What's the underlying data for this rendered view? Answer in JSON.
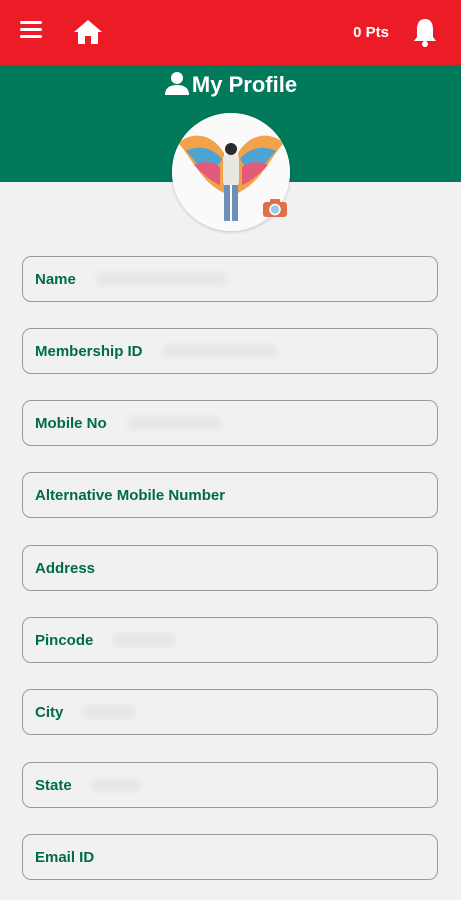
{
  "topbar": {
    "points_label": "0 Pts"
  },
  "page": {
    "title": "My Profile"
  },
  "fields": [
    {
      "label": "Name"
    },
    {
      "label": "Membership ID"
    },
    {
      "label": "Mobile No"
    },
    {
      "label": "Alternative Mobile Number"
    },
    {
      "label": "Address"
    },
    {
      "label": "Pincode"
    },
    {
      "label": "City"
    },
    {
      "label": "State"
    },
    {
      "label": "Email ID"
    }
  ],
  "colors": {
    "topbar": "#ec1c27",
    "banner": "#007a5a",
    "label": "#006b4a"
  },
  "icons": [
    "menu-icon",
    "home-icon",
    "bell-icon",
    "user-icon",
    "camera-icon"
  ]
}
